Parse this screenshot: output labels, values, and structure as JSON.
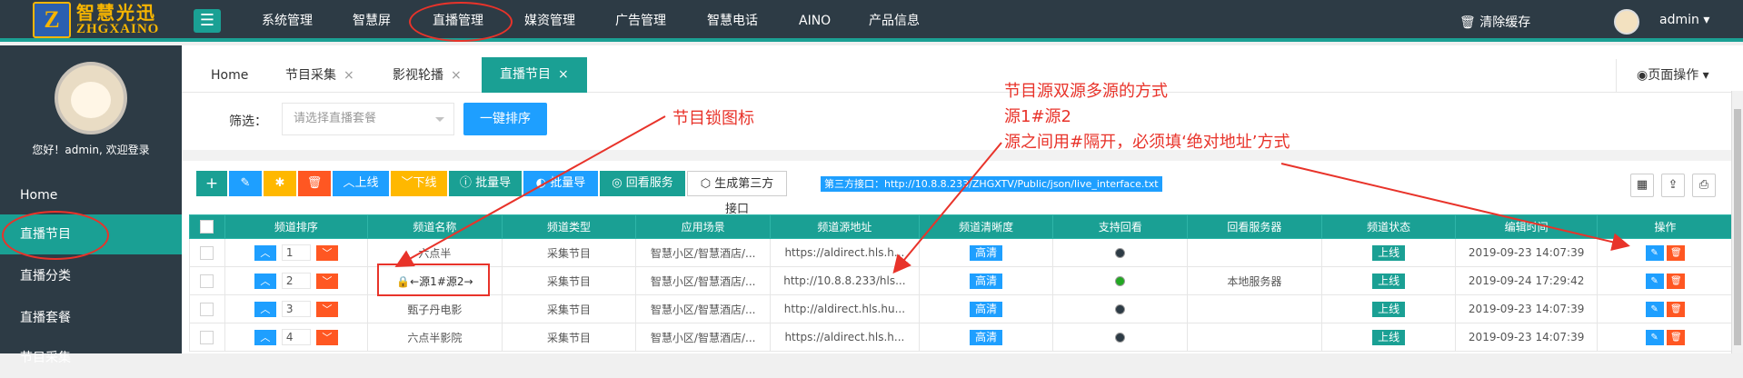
{
  "header": {
    "logo_cn": "智慧光迅",
    "logo_en": "ZHGXAINO",
    "nav": [
      "系统管理",
      "智慧屏",
      "直播管理",
      "媒资管理",
      "广告管理",
      "智慧电话",
      "AINO",
      "产品信息"
    ],
    "clear_cache": "清除缓存",
    "user": "admin"
  },
  "sidebar": {
    "welcome": "您好！admin, 欢迎登录",
    "items": [
      "Home",
      "直播节目",
      "直播分类",
      "直播套餐",
      "节目采集"
    ]
  },
  "tabs": [
    {
      "label": "Home",
      "closable": false
    },
    {
      "label": "节目采集",
      "closable": true
    },
    {
      "label": "影视轮播",
      "closable": true
    },
    {
      "label": "直播节目",
      "closable": true
    }
  ],
  "page_ops": "页面操作",
  "filter": {
    "label": "筛选：",
    "placeholder": "请选择直播套餐",
    "sort_button": "一键排序"
  },
  "toolbar": {
    "online": "上线",
    "offline": "下线",
    "batch_import": "批量导入",
    "batch_export": "批量导出",
    "replay_server": "回看服务器",
    "gen_third": "生成第三方接口",
    "api_text": "第三方接口：http://10.8.8.233/ZHGXTV/Public/json/live_interface.txt"
  },
  "table": {
    "headers": [
      "频道排序",
      "频道名称",
      "频道类型",
      "应用场景",
      "频道源地址",
      "频道清晰度",
      "支持回看",
      "回看服务器",
      "频道状态",
      "编辑时间",
      "操作"
    ],
    "rows": [
      {
        "order": "1",
        "name": "六点半",
        "type": "采集节目",
        "scene": "智慧小区/智慧酒店/...",
        "url": "https://aldirect.hls.h...",
        "quality": "高清",
        "replay": false,
        "server": "",
        "status": "上线",
        "time": "2019-09-23 14:07:39"
      },
      {
        "order": "2",
        "name": "←源1#源2→",
        "type": "采集节目",
        "scene": "智慧小区/智慧酒店/...",
        "url": "http://10.8.8.233/hls...",
        "quality": "高清",
        "replay": true,
        "server": "本地服务器",
        "status": "上线",
        "time": "2019-09-24 17:29:42"
      },
      {
        "order": "3",
        "name": "甄子丹电影",
        "type": "采集节目",
        "scene": "智慧小区/智慧酒店/...",
        "url": "http://aldirect.hls.hu...",
        "quality": "高清",
        "replay": false,
        "server": "",
        "status": "上线",
        "time": "2019-09-23 14:07:39"
      },
      {
        "order": "4",
        "name": "六点半影院",
        "type": "采集节目",
        "scene": "智慧小区/智慧酒店/...",
        "url": "https://aldirect.hls.h...",
        "quality": "高清",
        "replay": false,
        "server": "",
        "status": "上线",
        "time": "2019-09-23 14:07:39"
      }
    ]
  },
  "annotations": {
    "lock_note": "节目锁图标",
    "source_note1": "节目源双源多源的方式",
    "source_note2": "源1#源2",
    "source_note3": "源之间用#隔开，必须填‘绝对地址’方式"
  }
}
